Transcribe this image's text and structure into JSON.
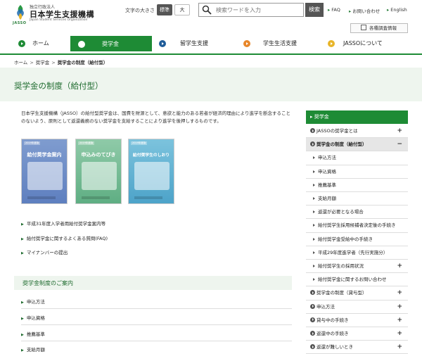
{
  "header": {
    "logo_sub": "独立行政法人",
    "logo_main": "日本学生支援機構",
    "logo_en": "Japan Student Services Organization",
    "logo_jasso": "JASSO",
    "fontsize_label": "文字の大きさ",
    "fontsize_normal": "標準",
    "fontsize_large": "大",
    "search_placeholder": "検索ワードを入力",
    "search_button": "検索",
    "links": [
      "FAQ",
      "お問い合わせ",
      "English"
    ],
    "survey_label": "各種調査情報"
  },
  "gnav": {
    "home": "ホーム",
    "scholarship": "奨学金",
    "study_abroad": "留学生支援",
    "student_life": "学生生活支援",
    "about": "JASSOについて"
  },
  "colors": {
    "green": "#1e8b35",
    "blue": "#1f5c99",
    "orange": "#e8872a",
    "yellow": "#e8b52a"
  },
  "breadcrumb": [
    "ホーム",
    "奨学金",
    "奨学金の制度（給付型）"
  ],
  "page_title": "奨学金の制度（給付型）",
  "intro": "日本学生支援機構（JASSO）の給付型奨学金は、国費を財源として、意欲と能力のある若者が経済的理由により進学を断念することのないよう、原則として返還義務のない奨学金を支給することにより進学を後押しするものです。",
  "booklets": [
    {
      "label": "2019年度版",
      "title": "給付奨学金案内"
    },
    {
      "label": "2019年度版",
      "title": "申込みのてびき"
    },
    {
      "label": "2019年度版",
      "title": "給付奨学生のしおり"
    }
  ],
  "doc_links": [
    "平成31年度入学者用給付奨学金案内等",
    "給付奨学金に関するよくある質問(FAQ)",
    "マイナンバーの提出"
  ],
  "guide": {
    "heading": "奨学金制度のご案内",
    "links": [
      "申込方法",
      "申込資格",
      "推薦基準",
      "支給月額"
    ]
  },
  "side_nav": {
    "header": "奨学金",
    "items": [
      {
        "label": "JASSOの奨学金とは",
        "level": 1,
        "toggle": "+"
      },
      {
        "label": "奨学金の制度（給付型）",
        "level": 1,
        "toggle": "−",
        "active": true
      },
      {
        "label": "申込方法",
        "level": 2
      },
      {
        "label": "申込資格",
        "level": 2
      },
      {
        "label": "推薦基準",
        "level": 2
      },
      {
        "label": "支給月額",
        "level": 2
      },
      {
        "label": "返還が必要となる場合",
        "level": 2
      },
      {
        "label": "給付奨学生採用候補者決定後の手続き",
        "level": 2
      },
      {
        "label": "給付奨学金受給中の手続き",
        "level": 2
      },
      {
        "label": "平成29年度進学者（先行実施分）",
        "level": 2
      },
      {
        "label": "給付奨学生の採用状況",
        "level": 2,
        "toggle": "+"
      },
      {
        "label": "給付奨学金に関するお問い合わせ",
        "level": 2
      },
      {
        "label": "奨学金の制度（貸与型）",
        "level": 1,
        "toggle": "+"
      },
      {
        "label": "申込方法",
        "level": 1,
        "toggle": "+"
      },
      {
        "label": "貸与中の手続き",
        "level": 1,
        "toggle": "+"
      },
      {
        "label": "返還中の手続き",
        "level": 1,
        "toggle": "+"
      },
      {
        "label": "返還が難しいとき",
        "level": 1,
        "toggle": "+"
      }
    ]
  }
}
